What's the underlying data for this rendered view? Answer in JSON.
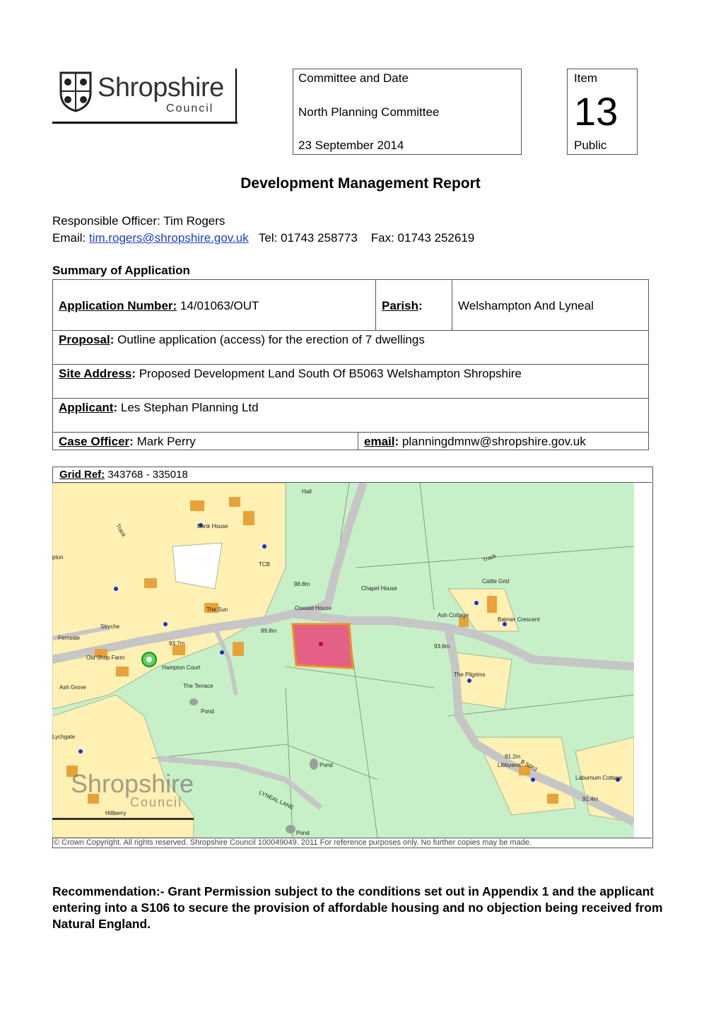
{
  "logo": {
    "org_name": "Shropshire",
    "org_sub": "Council"
  },
  "committee": {
    "heading": "Committee and Date",
    "name": "North Planning Committee",
    "date": "23 September 2014"
  },
  "item": {
    "heading": "Item",
    "number": "13",
    "status": "Public"
  },
  "report_title": "Development Management Report",
  "officer": {
    "label": "Responsible Officer:",
    "name": "Tim Rogers",
    "email_label": "Email:",
    "email": "tim.rogers@shropshire.gov.uk",
    "tel_label": "Tel:",
    "tel": "01743 258773",
    "fax_label": "Fax:",
    "fax": "01743 252619"
  },
  "summary_heading": "Summary of Application",
  "application": {
    "number_label": "Application Number:",
    "number": "14/01063/OUT",
    "parish_label": "Parish",
    "parish": "Welshampton And Lyneal",
    "proposal_label": "Proposal",
    "proposal": "Outline application (access) for the erection of 7 dwellings",
    "site_label": "Site Address",
    "site": "Proposed Development Land South Of B5063 Welshampton Shropshire",
    "applicant_label": "Applicant",
    "applicant": "Les Stephan Planning Ltd",
    "case_officer_label": "Case Officer",
    "case_officer": "Mark Perry",
    "email_label": "email",
    "email": "planningdmnw@shropshire.gov.uk"
  },
  "grid_ref": {
    "label": "Grid Ref:",
    "value": "343768 - 335018"
  },
  "map": {
    "labels": {
      "hall": "Hall",
      "bank_house": "Bank House",
      "track_1": "Track",
      "track_2": "Track",
      "pton": "pton",
      "tcb": "TCB",
      "bm_98": "98.8m",
      "cattle_grid": "Cattle Grid",
      "chapel_house": "Chapel House",
      "oswald_house": "Oswald House",
      "the_sun": "The Sun",
      "balmer_crescent": "Balmer Crescent",
      "ash_cottage": "Ash Cottage",
      "stryche": "Stryche",
      "bm_93_8": "93.8m",
      "bm_93_7": "93.7m",
      "bm_89": "89.8m",
      "the_pilgrims": "The Pilgrims",
      "old_shop_farm": "Old Shop Farm",
      "hampton_court": "Hampton Court",
      "the_terrace": "The Terrace",
      "ash_grove": "Ash Grove",
      "pond_1": "Pond",
      "pond_2": "Pond",
      "pond_3": "Pond",
      "lyneal_lane": "LYNEAL LANE",
      "road_b5063": "B 5063",
      "bm_91_2": "91.2m",
      "bm_91_4": "91.4m",
      "libbyann": "Libbyann",
      "laburnum_cottage": "Laburnum Cottage",
      "hillberry": "Hillberry",
      "lychgate": "Lychgate",
      "fernside": "Fernside",
      "watermark_main": "Shropshire",
      "watermark_sub": "Council"
    },
    "colors": {
      "field": "#c8f0c8",
      "building_plot": "#fff0b3",
      "road": "#c6c6c6",
      "site": "#e9467a",
      "site_border": "#f09020",
      "building": "#e8a23a",
      "point": "#1c2fd2"
    }
  },
  "copyright": "© Crown Copyright. All rights reserved.  Shropshire Council 100049049. 2011 For reference purposes only. No further copies may be made.",
  "recommendation": "Recommendation:-  Grant Permission subject to the conditions set out in Appendix 1 and the applicant entering into a S106 to secure the provision of affordable housing and no objection being received from Natural England."
}
